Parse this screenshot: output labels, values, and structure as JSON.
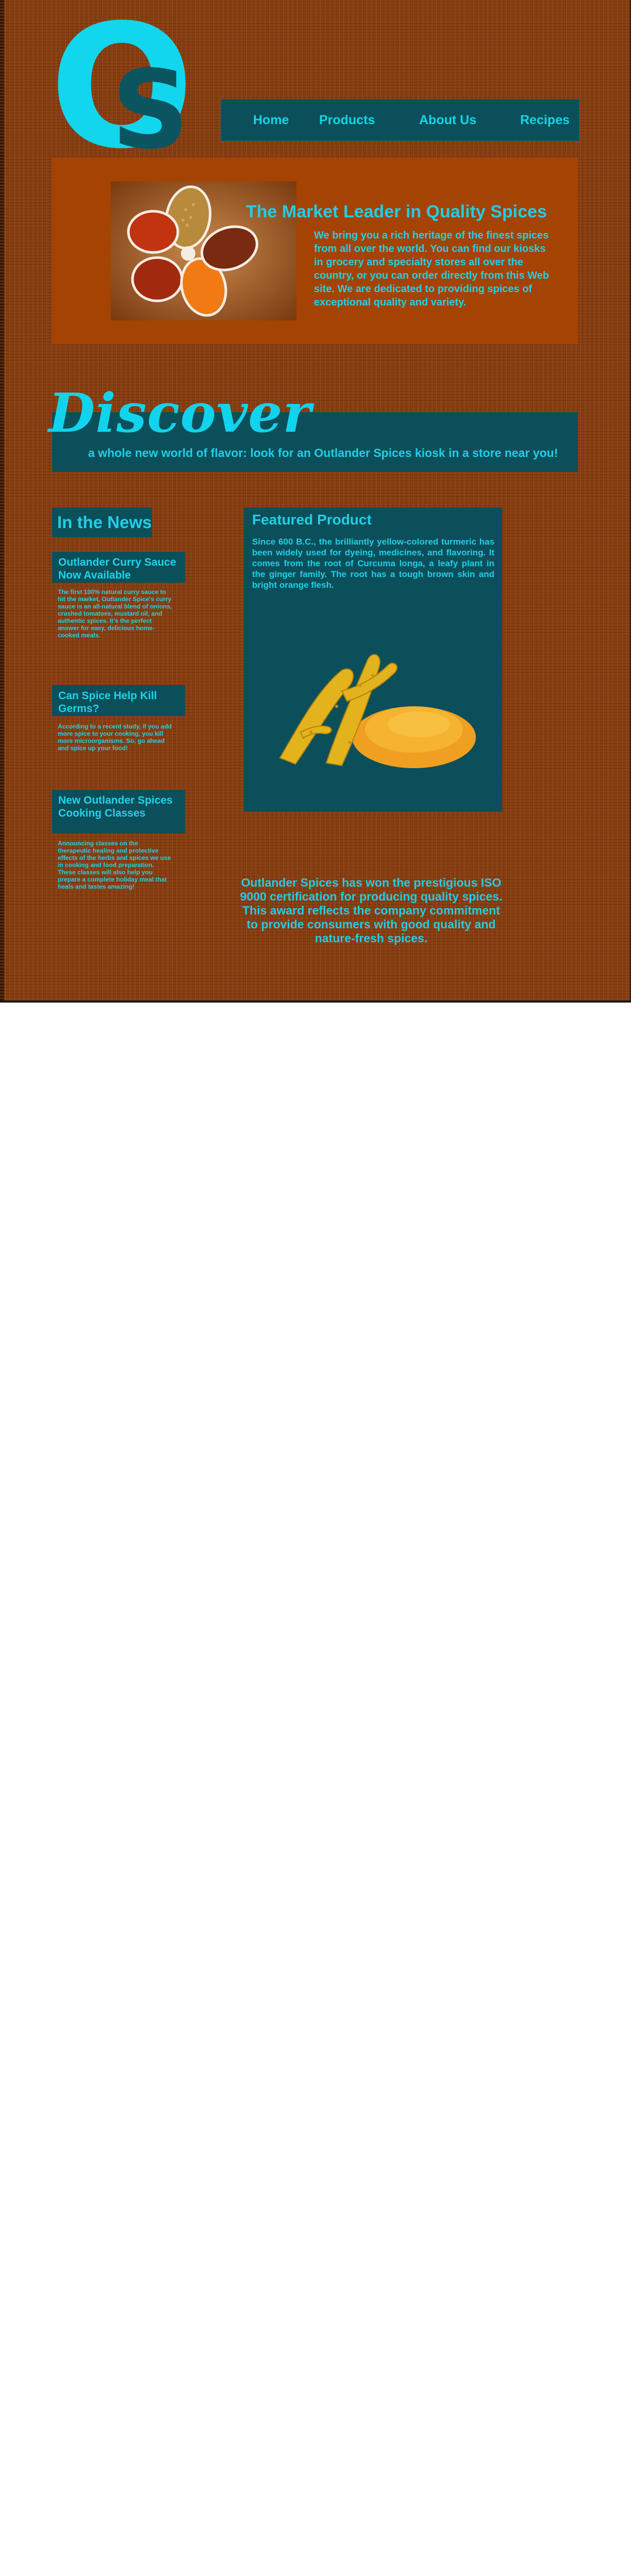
{
  "logo": {
    "letter_big": "O",
    "letter_small": "S"
  },
  "nav": {
    "items": [
      "Home",
      "Products",
      "About Us",
      "Recipes"
    ]
  },
  "hero": {
    "image": "spice-flower-bowls",
    "title": "The Market Leader in Quality Spices",
    "body": "We bring you a rich heritage of the finest spices from all over the world. You can find our kiosks in grocery and specialty stores all over the country, or you can order directly from this Web site. We are dedicated to providing spices of exceptional quality and variety."
  },
  "discover": {
    "heading": "Discover",
    "tagline": "a whole new world of flavor: look for an Outlander Spices kiosk in a store near you!"
  },
  "news": {
    "heading": "In the News",
    "items": [
      {
        "title": "Outlander Curry Sauce Now Available",
        "body": "The first 100% natural curry sauce to hit the market, Outlander Spice's curry sauce is an all-natural blend of onions, crushed tomatoes, mustard oil, and authentic spices. It's the perfect answer for easy, delicious home-cooked meals."
      },
      {
        "title": "Can Spice Help Kill Germs?",
        "body": "According to a recent study, if you add more spice to your cooking, you kill more microorganisms. So, go ahead and spice up your food!"
      },
      {
        "title": "New Outlander Spices Cooking Classes",
        "body": "Announcing classes on the therapeutic healing and protective effects of the herbs and spices we use in cooking and food preparation. These classes will also help you prepare a complete holiday meal that heals and tastes amazing!"
      }
    ]
  },
  "featured": {
    "title": "Featured Product",
    "body": "Since 600 B.C., the brilliantly yellow-colored turmeric has been widely used for dyeing, medicines, and flavoring. It comes from the root of Curcuma longa, a leafy plant in the ginger family. The root has a tough brown skin and bright orange flesh.",
    "image": "turmeric-root-and-powder"
  },
  "award": "Outlander Spices has won the prestigious ISO 9000 certification for producing quality spices. This award reflects the company commitment to provide consumers with good quality and nature-fresh spices.",
  "colors": {
    "background": "#8b3f12",
    "panel": "#0b4f5a",
    "accent": "#1fd3ea",
    "hero_panel": "#a44303"
  }
}
